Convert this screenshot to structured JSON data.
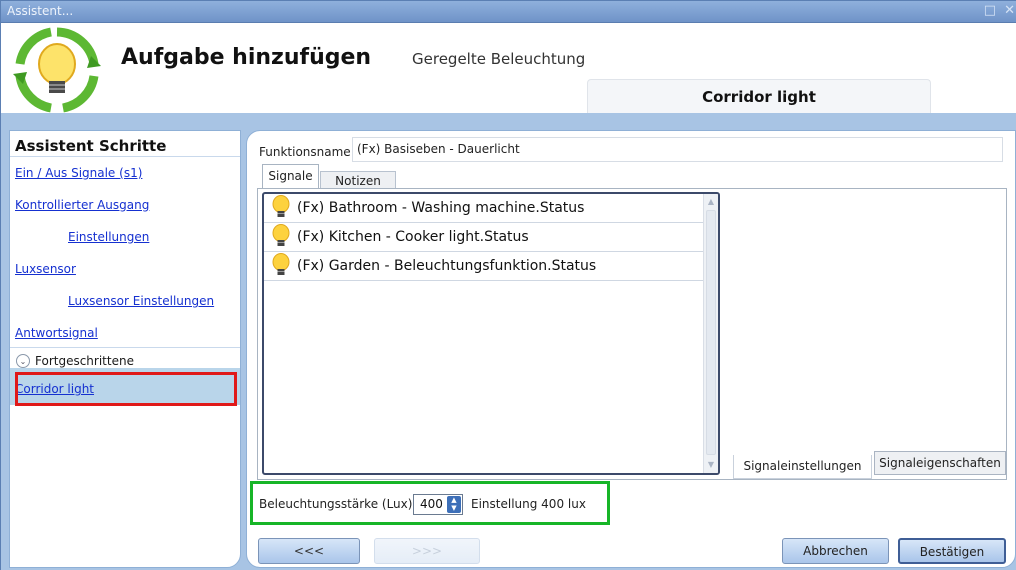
{
  "window": {
    "title": "Assistent...",
    "controls": "□ ✕"
  },
  "header": {
    "title": "Aufgabe hinzufügen",
    "subtitle": "Geregelte Beleuchtung",
    "task_tab": "Corridor light"
  },
  "steps": {
    "title": "Assistent Schritte",
    "items": [
      {
        "label": "Ein / Aus Signale (s1)"
      },
      {
        "label": "Kontrollierter Ausgang"
      },
      {
        "label": "Einstellungen"
      },
      {
        "label": "Luxsensor"
      },
      {
        "label": "Luxsensor Einstellungen"
      },
      {
        "label": "Antwortsignal"
      }
    ],
    "advanced_label": "Fortgeschrittene",
    "active_item": "Corridor light"
  },
  "form": {
    "function_name_label": "Funktionsname",
    "function_name_value": "(Fx) Basiseben - Dauerlicht"
  },
  "tabs": {
    "signale": "Signale",
    "notizen": "Notizen"
  },
  "signals": [
    {
      "label": "(Fx) Bathroom - Washing machine.Status",
      "icon": "lightbulb-icon"
    },
    {
      "label": "(Fx) Kitchen - Cooker light.Status",
      "icon": "lightbulb-icon"
    },
    {
      "label": "(Fx) Garden - Beleuchtungsfunktion.Status",
      "icon": "lightbulb-icon"
    }
  ],
  "bottom_tabs": {
    "settings": "Signaleinstellungen",
    "properties": "Signaleigenschaften"
  },
  "lux": {
    "label": "Beleuchtungsstärke (Lux)",
    "value": "400",
    "text": "Einstellung 400 lux"
  },
  "buttons": {
    "back": "<<<",
    "forward": ">>>",
    "cancel": "Abbrechen",
    "confirm": "Bestätigen"
  },
  "colors": {
    "highlight_red": "#e01919",
    "highlight_green": "#17b528",
    "link": "#1530d0",
    "frame_blue": "#a8c4e4"
  }
}
